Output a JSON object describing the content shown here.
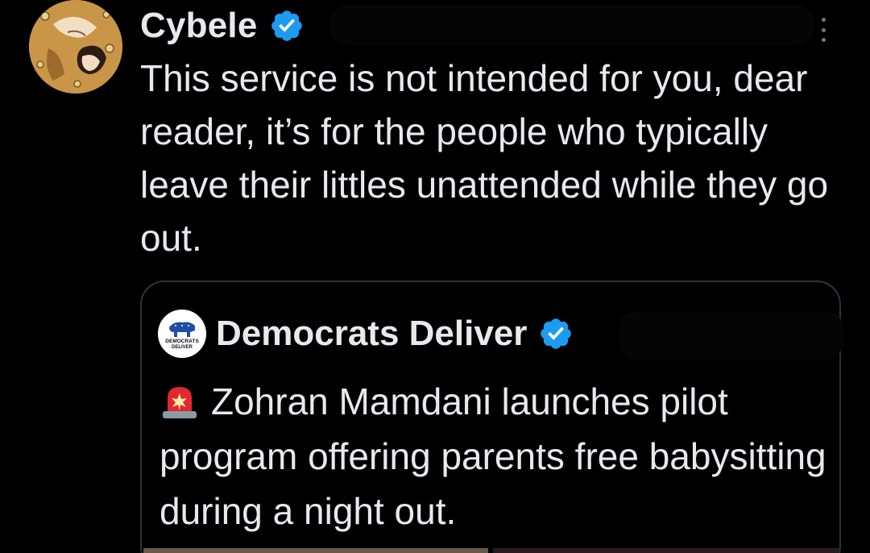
{
  "tweet": {
    "author": {
      "name": "Cybele",
      "verified": true,
      "avatar_icon": "klimt-painting-avatar"
    },
    "text": "This service is not intended for you, dear reader, it’s for the people who typically leave their littles unattended while they go out.",
    "more_icon": "more-options-icon"
  },
  "quote": {
    "author": {
      "name": "Democrats Deliver",
      "verified": true,
      "avatar_text_line1": "DEMOCRATS",
      "avatar_text_line2": "DELIVER"
    },
    "emoji": "rotating-light-icon",
    "text": "Zohran Mamdani launches pilot program offering parents free babysitting during a night out."
  },
  "colors": {
    "background": "#000000",
    "text": "#e7e9ea",
    "verified_badge": "#1d9bf0",
    "border": "#2f3336",
    "muted": "#71767b"
  }
}
